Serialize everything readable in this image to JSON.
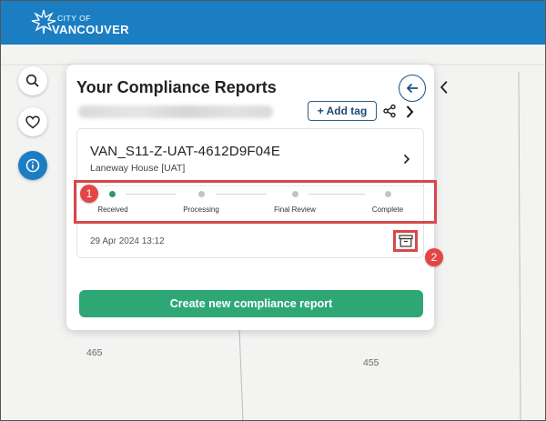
{
  "header": {
    "logo_city": "CITY OF",
    "logo_name": "VANCOUVER"
  },
  "map": {
    "lots": [
      "465",
      "455"
    ]
  },
  "rail": {
    "search_icon": "search-icon",
    "favorite_icon": "heart-icon",
    "info_icon": "info-icon"
  },
  "panel": {
    "title": "Your Compliance Reports",
    "add_tag_label": "+ Add tag",
    "report": {
      "id": "VAN_S11-Z-UAT-4612D9F04E",
      "type": "Laneway House [UAT]",
      "date": "29 Apr 2024 13:12",
      "steps": [
        {
          "label": "Received",
          "status": "complete"
        },
        {
          "label": "Processing",
          "status": "pending"
        },
        {
          "label": "Final Review",
          "status": "pending"
        },
        {
          "label": "Complete",
          "status": "pending"
        }
      ]
    },
    "create_label": "Create new compliance report"
  },
  "annotations": {
    "badge_1": "1",
    "badge_2": "2"
  },
  "colors": {
    "header": "#1b7ec2",
    "accent_green": "#2ea775",
    "annotation_red": "#d8474d"
  }
}
